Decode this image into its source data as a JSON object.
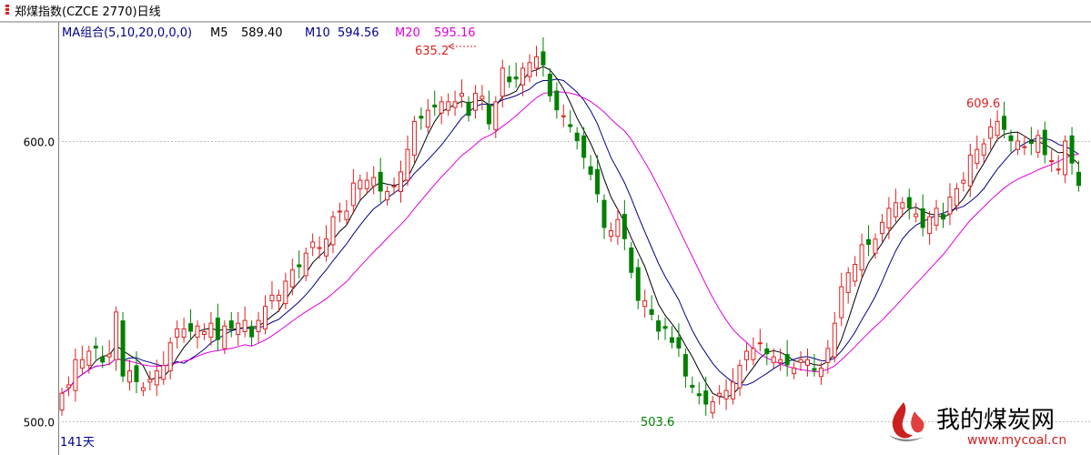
{
  "window": {
    "title": "郑煤指数(CZCE 2770)日线",
    "period": "141天"
  },
  "indicator": {
    "name": "MA组合(5,10,20,0,0,0)",
    "m5_label": "M5",
    "m5_value": "589.40",
    "m10_label": "M10",
    "m10_value": "594.56",
    "m20_label": "M20",
    "m20_value": "595.16"
  },
  "colors": {
    "up": "#e02020",
    "down": "#008000",
    "ma5": "#000000",
    "ma10": "#00008b",
    "ma20": "#e000e0",
    "grid": "#c0c0c0"
  },
  "annotations": {
    "high_label": "635.2",
    "low_label": "503.6",
    "right_high_label": "609.6"
  },
  "watermark": {
    "brand": "我的煤炭网",
    "url": "www.mycoal.cn"
  },
  "chart_data": {
    "type": "candlestick",
    "title": "郑煤指数(CZCE 2770)日线",
    "y_ticks": [
      600.0,
      500.0
    ],
    "y_tick_labels": [
      "600.0",
      "500.0"
    ],
    "ylim": [
      499,
      636
    ],
    "grid": true,
    "closes": [
      510,
      513,
      522,
      522,
      525,
      526,
      521,
      524,
      539,
      516,
      518,
      514,
      512,
      515,
      518,
      520,
      528,
      533,
      533,
      532,
      534,
      532,
      535,
      529,
      534,
      533,
      535,
      536,
      530,
      536,
      541,
      545,
      545,
      550,
      554,
      555,
      560,
      564,
      562,
      565,
      573,
      575,
      575,
      585,
      586,
      586,
      587,
      582,
      582,
      584,
      589,
      597,
      607,
      608,
      611,
      612,
      614,
      614,
      614,
      617,
      609,
      617,
      616,
      606,
      614,
      626,
      621,
      622,
      626,
      628,
      630,
      627,
      616,
      611,
      609,
      605,
      600,
      594,
      588,
      581,
      569,
      568,
      572,
      565,
      553,
      543,
      543,
      538,
      532,
      533,
      528,
      526,
      516,
      512,
      509,
      506,
      507,
      510,
      511,
      514,
      520,
      525,
      526,
      528,
      524,
      523,
      522,
      520,
      519,
      522,
      522,
      518,
      519,
      526,
      535,
      548,
      553,
      556,
      563,
      563,
      565,
      571,
      576,
      578,
      578,
      576,
      574,
      569,
      573,
      576,
      572,
      580,
      583,
      586,
      595,
      597,
      599,
      605,
      607,
      604,
      600,
      600,
      598,
      599,
      602,
      595,
      593,
      590,
      600,
      592,
      584
    ]
  }
}
